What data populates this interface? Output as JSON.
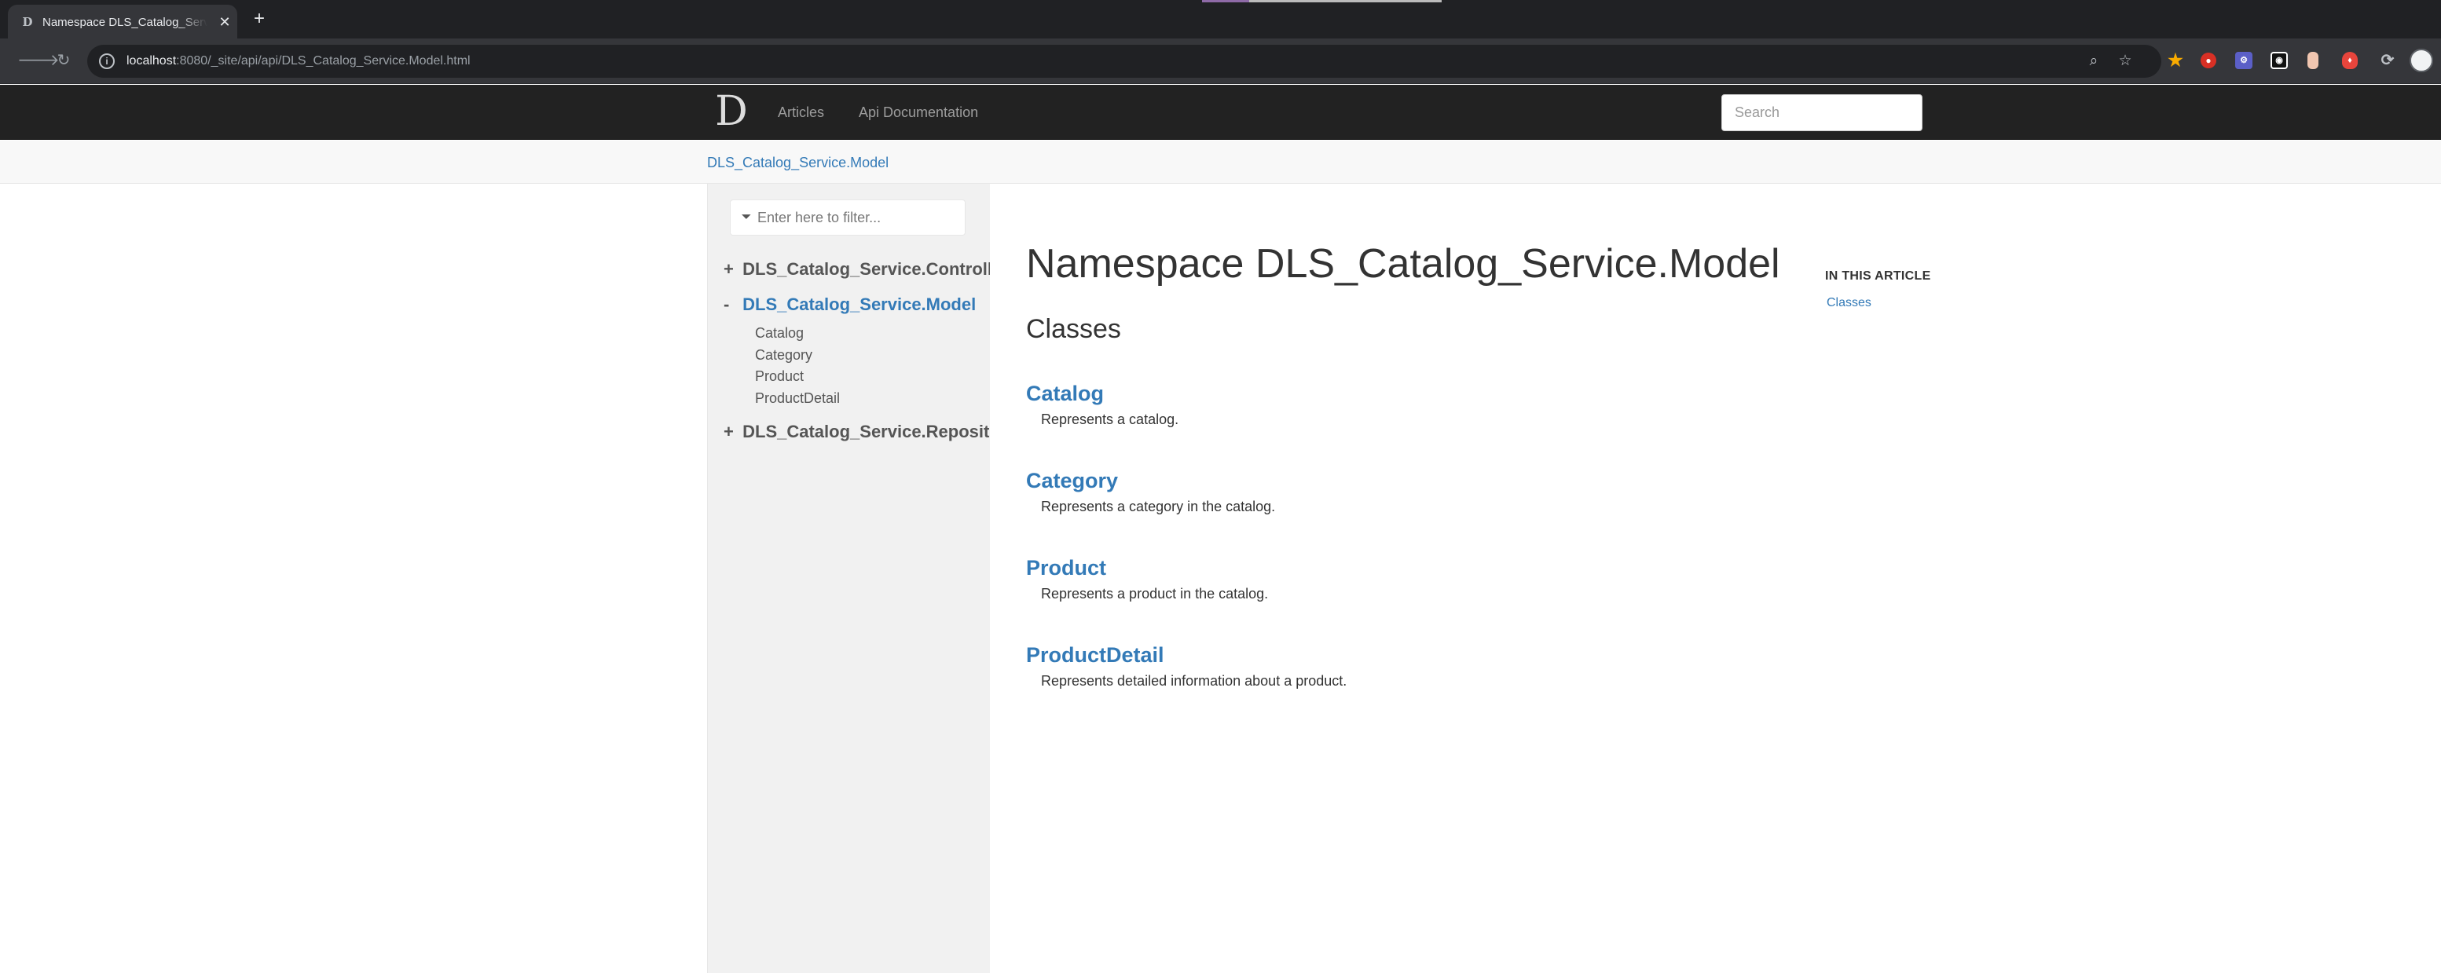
{
  "browser": {
    "tab_title": "Namespace DLS_Catalog_Service.Model",
    "tab_favicon": "D",
    "close_glyph": "✕",
    "new_tab_glyph": "+",
    "url_host": "localhost",
    "url_rest": ":8080/_site/api/api/DLS_Catalog_Service.Model.html",
    "icons": {
      "back": "🡒",
      "reload": "↻",
      "info": "i",
      "zoom": "⌕",
      "star": "☆"
    },
    "extensions": [
      "star-ext-icon",
      "red-ext-icon",
      "puzzle-ext-icon",
      "shield-ext-icon",
      "bottle-ext-icon",
      "fire-ext-icon",
      "sync-icon",
      "profile-avatar"
    ]
  },
  "navbar": {
    "brand": "D",
    "links": [
      "Articles",
      "Api Documentation"
    ],
    "search_placeholder": "Search"
  },
  "breadcrumb": "DLS_Catalog_Service.Model",
  "sidebar": {
    "filter_placeholder": "Enter here to filter...",
    "filter_icon": "⏷",
    "namespaces": [
      {
        "toggle": "+",
        "label": "DLS_Catalog_Service.Controllers",
        "active": false
      },
      {
        "toggle": "-",
        "label": "DLS_Catalog_Service.Model",
        "active": true,
        "children": [
          "Catalog",
          "Category",
          "Product",
          "ProductDetail"
        ]
      },
      {
        "toggle": "+",
        "label": "DLS_Catalog_Service.Repositories",
        "active": false
      }
    ]
  },
  "article": {
    "title": "Namespace DLS_Catalog_Service.Model",
    "section": "Classes",
    "classes": [
      {
        "name": "Catalog",
        "summary": "Represents a catalog."
      },
      {
        "name": "Category",
        "summary": "Represents a category in the catalog."
      },
      {
        "name": "Product",
        "summary": "Represents a product in the catalog."
      },
      {
        "name": "ProductDetail",
        "summary": "Represents detailed information about a product."
      }
    ]
  },
  "affix": {
    "title": "IN THIS ARTICLE",
    "links": [
      "Classes"
    ]
  },
  "colors": {
    "link": "#337ab7",
    "navbar_bg": "#222222",
    "sidebar_bg": "#f1f1f1",
    "chrome_bg": "#35363a"
  }
}
